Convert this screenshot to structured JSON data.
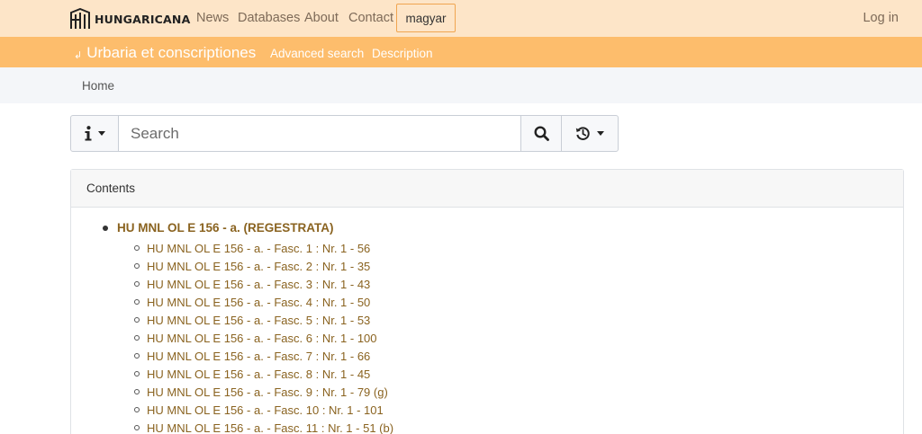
{
  "brand": {
    "name": "HUNGARICANA"
  },
  "nav": {
    "items": [
      {
        "label": "News"
      },
      {
        "label": "Databases"
      },
      {
        "label": "About"
      },
      {
        "label": "Contact"
      }
    ],
    "language": "magyar",
    "login": "Log in"
  },
  "subnav": {
    "title": "Urbaria et conscriptiones",
    "links": [
      {
        "label": "Advanced search"
      },
      {
        "label": "Description"
      }
    ]
  },
  "breadcrumb": {
    "home": "Home"
  },
  "search": {
    "placeholder": "Search"
  },
  "icons": {
    "info": "info-icon",
    "search": "search-icon",
    "history": "history-icon",
    "back": "back-arrow-icon"
  },
  "colors": {
    "topbar": "#fde5c8",
    "subbar": "#fdbd6c",
    "link": "#8a6320",
    "nav_text": "#7d6a58"
  },
  "contents": {
    "header": "Contents",
    "root": {
      "label": "HU MNL OL E 156 - a. (REGESTRATA)",
      "children": [
        {
          "label": "HU MNL OL E 156 - a. - Fasc. 1 : Nr. 1 - 56"
        },
        {
          "label": "HU MNL OL E 156 - a. - Fasc. 2 : Nr. 1 - 35"
        },
        {
          "label": "HU MNL OL E 156 - a. - Fasc. 3 : Nr. 1 - 43"
        },
        {
          "label": "HU MNL OL E 156 - a. - Fasc. 4 : Nr. 1 - 50"
        },
        {
          "label": "HU MNL OL E 156 - a. - Fasc. 5 : Nr. 1 - 53"
        },
        {
          "label": "HU MNL OL E 156 - a. - Fasc. 6 : Nr. 1 - 100"
        },
        {
          "label": "HU MNL OL E 156 - a. - Fasc. 7 : Nr. 1 - 66"
        },
        {
          "label": "HU MNL OL E 156 - a. - Fasc. 8 : Nr. 1 - 45"
        },
        {
          "label": "HU MNL OL E 156 - a. - Fasc. 9 : Nr. 1 - 79 (g)"
        },
        {
          "label": "HU MNL OL E 156 - a. - Fasc. 10 : Nr. 1 - 101"
        },
        {
          "label": "HU MNL OL E 156 - a. - Fasc. 11 : Nr. 1 - 51 (b)"
        }
      ]
    }
  }
}
